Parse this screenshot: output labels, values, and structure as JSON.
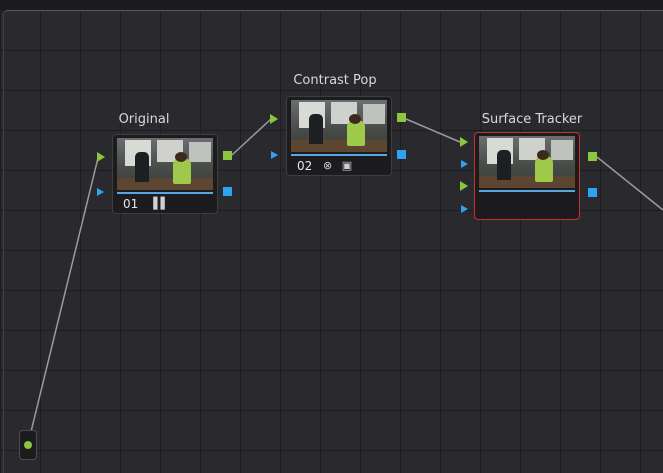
{
  "nodes": [
    {
      "id": "original",
      "title": "Original",
      "number": "01",
      "badge_icon": "bars-icon"
    },
    {
      "id": "contrast",
      "title": "Contrast Pop",
      "number": "02",
      "badge_icon": "effects-icon"
    },
    {
      "id": "tracker",
      "title": "Surface Tracker",
      "number": "",
      "selected": true
    }
  ],
  "colors": {
    "rgb_port": "#8cc63f",
    "alpha_port": "#2ea3f2",
    "selected_border": "#c8322c",
    "link": "#9a9aa0"
  }
}
